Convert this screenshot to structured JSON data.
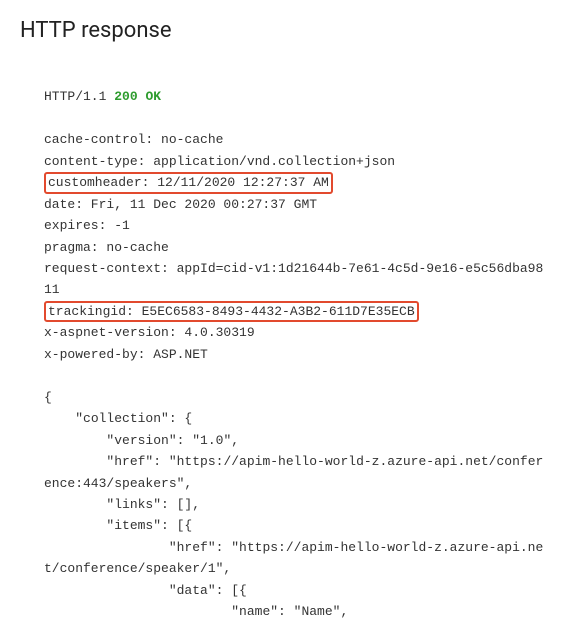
{
  "title": "HTTP response",
  "http": {
    "protocol": "HTTP/1.1",
    "status": "200 OK"
  },
  "headers": {
    "cache_control": "cache-control: no-cache",
    "content_type": "content-type: application/vnd.collection+json",
    "customheader": "customheader: 12/11/2020 12:27:37 AM",
    "date": "date: Fri, 11 Dec 2020 00:27:37 GMT",
    "expires": "expires: -1",
    "pragma": "pragma: no-cache",
    "request_context": "request-context: appId=cid-v1:1d21644b-7e61-4c5d-9e16-e5c56dba9811",
    "trackingid": "trackingid: E5EC6583-8493-4432-A3B2-611D7E35ECB",
    "x_aspnet_version": "x-aspnet-version: 4.0.30319",
    "x_powered_by": "x-powered-by: ASP.NET"
  },
  "body": {
    "line1": "{",
    "line2": "    \"collection\": {",
    "line3": "        \"version\": \"1.0\",",
    "line4": "        \"href\": \"https://apim-hello-world-z.azure-api.net/conference:443/speakers\",",
    "line5": "        \"links\": [],",
    "line6": "        \"items\": [{",
    "line7": "                \"href\": \"https://apim-hello-world-z.azure-api.net/conference/speaker/1\",",
    "line8": "                \"data\": [{",
    "line9": "                        \"name\": \"Name\","
  }
}
